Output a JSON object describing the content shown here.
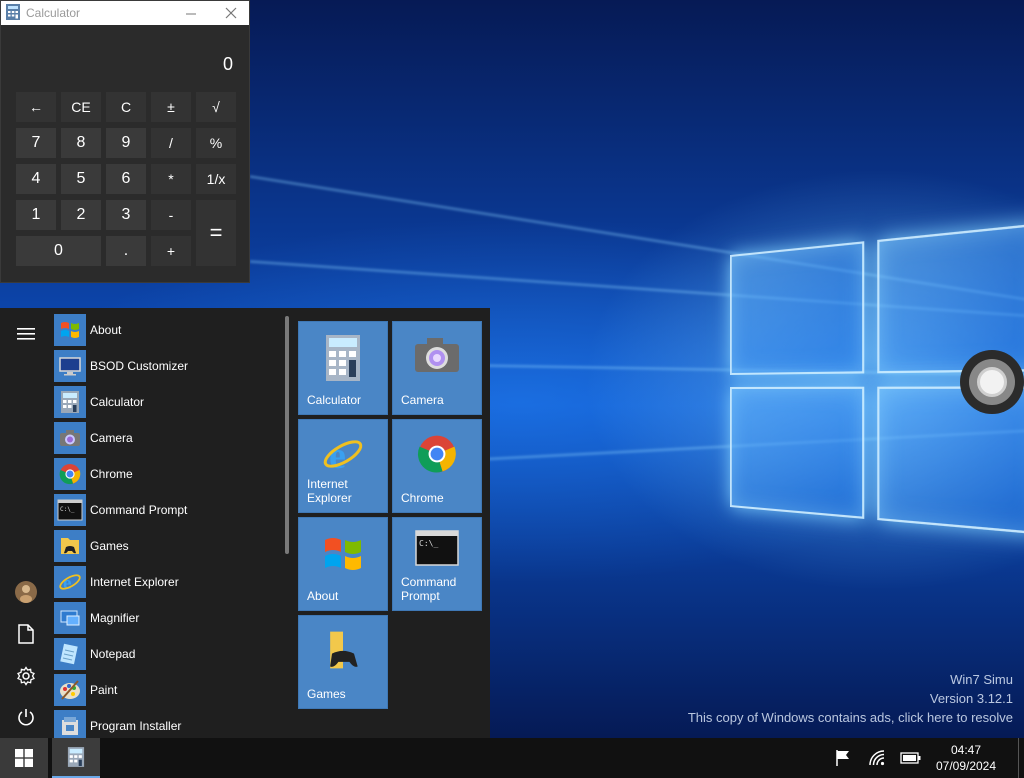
{
  "calculator": {
    "title": "Calculator",
    "display": "0",
    "keys": {
      "back": "←",
      "ce": "CE",
      "c": "C",
      "plusminus": "±",
      "sqrt": "√",
      "k7": "7",
      "k8": "8",
      "k9": "9",
      "div": "/",
      "pct": "%",
      "k4": "4",
      "k5": "5",
      "k6": "6",
      "mul": "*",
      "inv": "1/x",
      "k1": "1",
      "k2": "2",
      "k3": "3",
      "sub": "-",
      "eq": "=",
      "k0": "0",
      "dot": ".",
      "add": "+"
    }
  },
  "start_menu": {
    "apps": [
      {
        "label": "About",
        "icon": "windows-logo-icon"
      },
      {
        "label": "BSOD Customizer",
        "icon": "monitor-icon"
      },
      {
        "label": "Calculator",
        "icon": "calculator-icon"
      },
      {
        "label": "Camera",
        "icon": "camera-icon"
      },
      {
        "label": "Chrome",
        "icon": "chrome-icon"
      },
      {
        "label": "Command Prompt",
        "icon": "terminal-icon"
      },
      {
        "label": "Games",
        "icon": "games-folder-icon"
      },
      {
        "label": "Internet Explorer",
        "icon": "internet-explorer-icon"
      },
      {
        "label": "Magnifier",
        "icon": "magnifier-icon"
      },
      {
        "label": "Notepad",
        "icon": "notepad-icon"
      },
      {
        "label": "Paint",
        "icon": "paint-icon"
      },
      {
        "label": "Program Installer",
        "icon": "installer-icon"
      }
    ],
    "tiles": [
      {
        "label": "Calculator",
        "icon": "calculator-icon"
      },
      {
        "label": "Camera",
        "icon": "camera-icon"
      },
      {
        "label": "Internet Explorer",
        "icon": "internet-explorer-icon"
      },
      {
        "label": "Chrome",
        "icon": "chrome-icon"
      },
      {
        "label": "About",
        "icon": "windows-logo-icon"
      },
      {
        "label": "Command Prompt",
        "icon": "terminal-icon"
      },
      {
        "label": "Games",
        "icon": "games-folder-icon"
      }
    ]
  },
  "watermark": {
    "line1": "Win7 Simu",
    "line2": "Version 3.12.1",
    "line3": "This copy of Windows contains ads, click here to resolve"
  },
  "taskbar": {
    "time": "04:47",
    "date": "07/09/2024"
  },
  "colors": {
    "tile": "#4a86c6",
    "menu_bg": "#1f1f1f",
    "calc_bg": "#2b2b2b",
    "taskbar": "#111111"
  }
}
